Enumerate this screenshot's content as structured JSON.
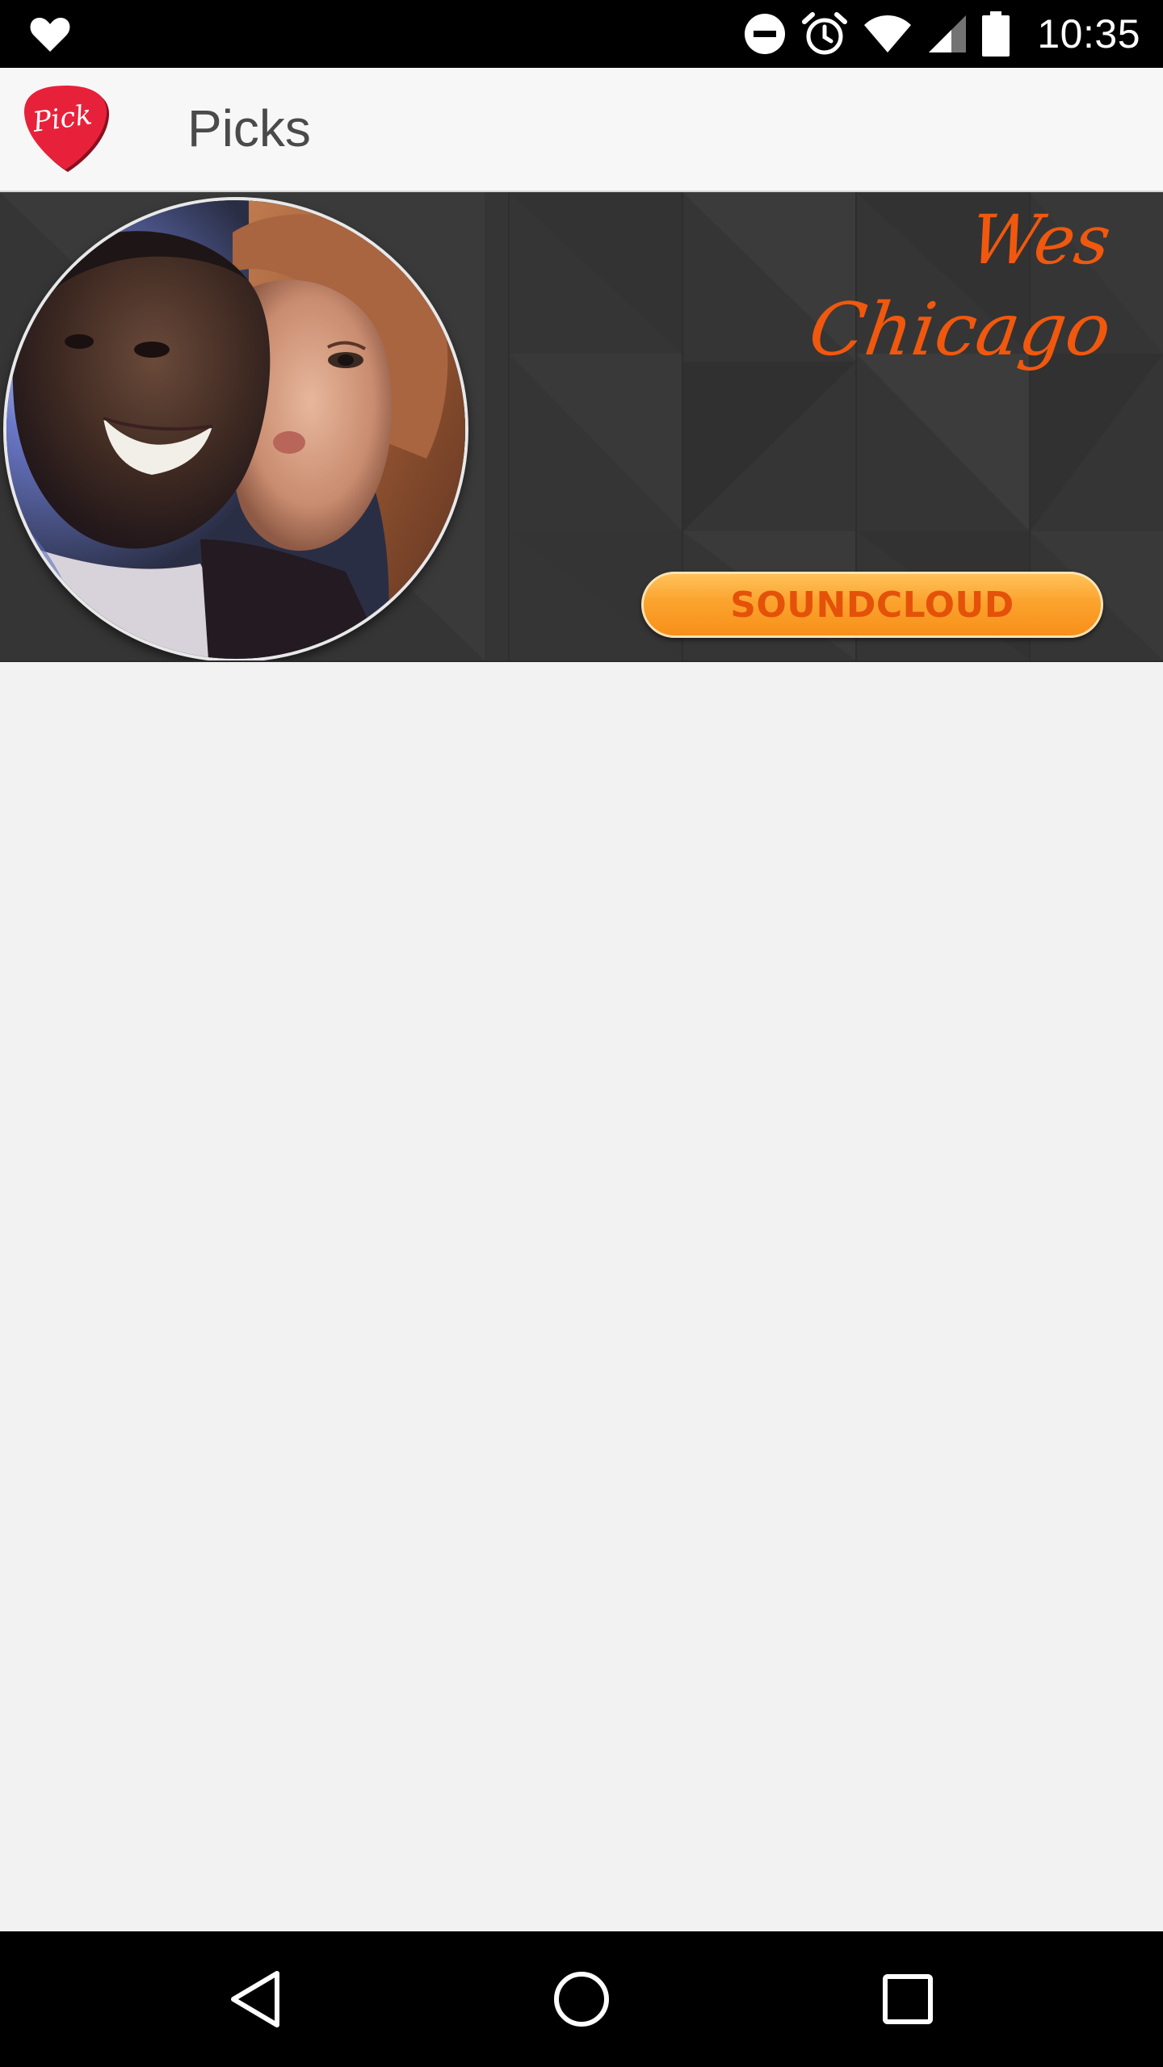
{
  "status_bar": {
    "time": "10:35",
    "icons": [
      "heart-icon",
      "do-not-disturb-icon",
      "alarm-icon",
      "wifi-icon",
      "cell-signal-icon",
      "battery-icon"
    ]
  },
  "action_bar": {
    "title": "Picks",
    "logo_text": "Pick",
    "logo_color": "#e8213a"
  },
  "profile": {
    "name": "Wes",
    "city": "Chicago",
    "accent_color": "#f0580e",
    "soundcloud_label": "SOUNDCLOUD"
  },
  "nav_bar": {
    "buttons": [
      "back-icon",
      "home-icon",
      "recents-icon"
    ]
  }
}
